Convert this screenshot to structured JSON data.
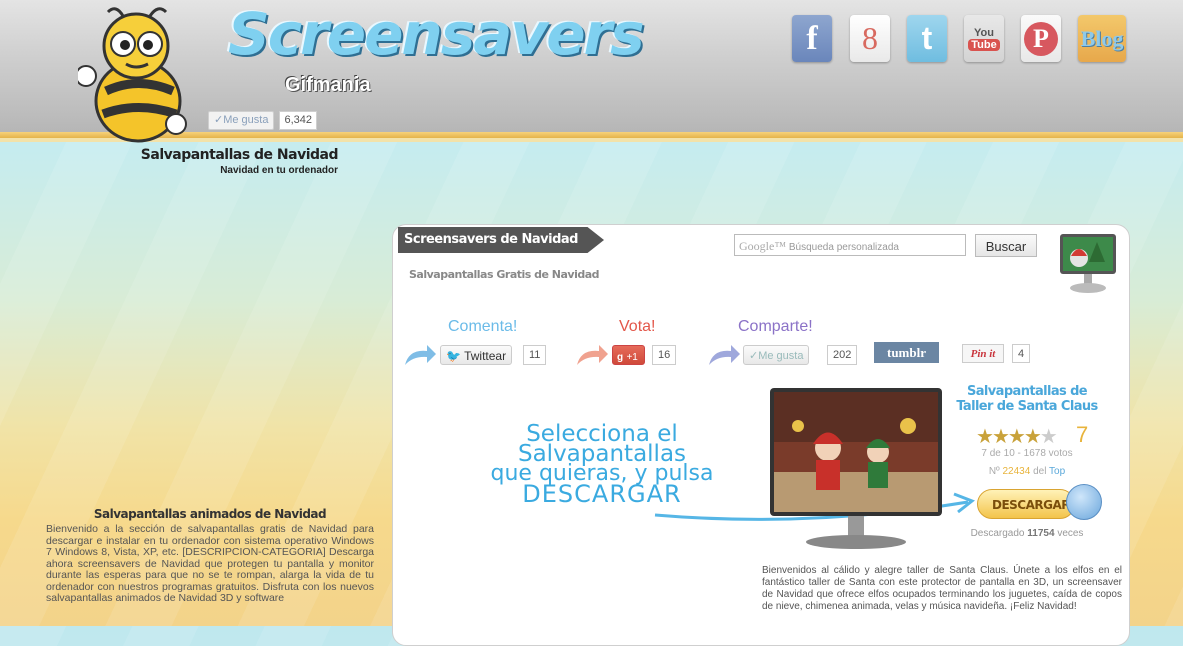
{
  "header": {
    "logo_title": "Screensavers",
    "logo_subtitle": "Gifmania",
    "like_label": "✓Me gusta",
    "like_count": "6,342",
    "social": {
      "facebook": "f",
      "google": "8",
      "twitter": "t",
      "youtube_top": "You",
      "youtube_bottom": "Tube",
      "pinterest": "P",
      "blog": "Blog"
    }
  },
  "page": {
    "title": "Salvapantallas de Navidad",
    "subtitle": "Navidad en tu ordenador"
  },
  "left_section": {
    "heading": "Salvapantallas animados de Navidad",
    "body": "Bienvenido a la sección de salvapantallas gratis de Navidad para descargar e instalar en tu ordenador con sistema operativo Windows 7 Windows 8, Vista, XP, etc. [DESCRIPCION-CATEGORIA] Descarga ahora screensavers de Navidad que protegen tu pantalla y monitor durante las esperas para que no se te rompan, alarga la vida de tu ordenador con nuestros programas gratuitos. Disfruta con los nuevos salvapantallas animados de Navidad 3D y software"
  },
  "panel": {
    "tab_title": "Screensavers de Navidad",
    "subtitle": "Salvapantallas Gratis de Navidad",
    "search_placeholder": "Búsqueda personalizada",
    "search_google": "Google™",
    "search_button": "Buscar"
  },
  "actions": {
    "comenta": "Comenta!",
    "vota": "Vota!",
    "comparte": "Comparte!",
    "tweet_label": "Twittear",
    "tweet_count": "11",
    "gplus_label": "+1",
    "gplus_count": "16",
    "fb_like_label": "✓Me gusta",
    "fb_like_count": "202",
    "tumblr": "tumblr",
    "pinit": "Pin it",
    "pin_count": "4"
  },
  "callout": {
    "line1": "Selecciona el Salvapantallas",
    "line2": "que quieras, y pulsa",
    "line3": "DESCARGAR"
  },
  "screensaver": {
    "title": "Salvapantallas de Taller de Santa Claus",
    "rating": "7",
    "rating_stars": 3.5,
    "votes_text": "7 de 10 - 1678 votos",
    "rank_prefix": "Nº",
    "rank_number": "22434",
    "rank_mid": "del",
    "rank_top": "Top",
    "download_label": "DESCARGAR",
    "downloaded_prefix": "Descargado",
    "downloaded_count": "11754",
    "downloaded_suffix": "veces",
    "description": "Bienvenidos al cálido y alegre taller de Santa Claus. Únete a los elfos en el fantástico taller de Santa con este protector de pantalla en 3D, un screensaver de Navidad que ofrece elfos ocupados terminando los juguetes, caída de copos de nieve, chimenea animada, velas y música navideña. ¡Feliz Navidad!"
  }
}
